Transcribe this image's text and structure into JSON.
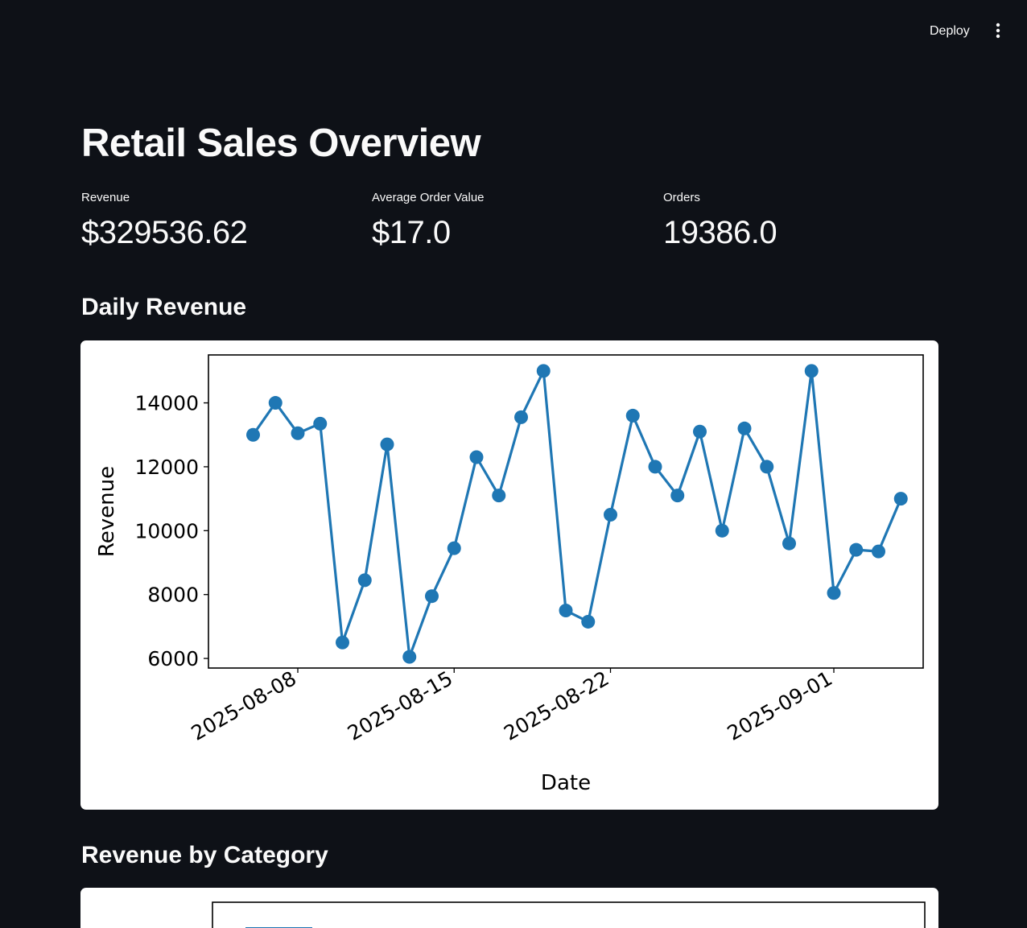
{
  "header": {
    "deploy_label": "Deploy",
    "menu_icon": "vertical-ellipsis-icon"
  },
  "page": {
    "title": "Retail Sales Overview"
  },
  "metrics": [
    {
      "label": "Revenue",
      "value": "$329536.62"
    },
    {
      "label": "Average Order Value",
      "value": "$17.0"
    },
    {
      "label": "Orders",
      "value": "19386.0"
    }
  ],
  "sections": {
    "daily_revenue": "Daily Revenue",
    "revenue_by_category": "Revenue by Category"
  },
  "colors": {
    "background": "#0e1117",
    "text": "#fafafa",
    "series": "#1f77b4"
  },
  "chart_data": [
    {
      "type": "line",
      "title": "",
      "xlabel": "Date",
      "ylabel": "Revenue",
      "ylim": [
        5700,
        15500
      ],
      "xlim": [
        "2025-08-04",
        "2025-09-05"
      ],
      "yticks": [
        6000,
        8000,
        10000,
        12000,
        14000
      ],
      "xticks": [
        "2025-08-08",
        "2025-08-15",
        "2025-08-22",
        "2025-09-01"
      ],
      "grid": false,
      "markers": true,
      "series": [
        {
          "x": [
            "2025-08-06",
            "2025-08-07",
            "2025-08-08",
            "2025-08-09",
            "2025-08-10",
            "2025-08-11",
            "2025-08-12",
            "2025-08-13",
            "2025-08-14",
            "2025-08-15",
            "2025-08-16",
            "2025-08-17",
            "2025-08-18",
            "2025-08-19",
            "2025-08-20",
            "2025-08-21",
            "2025-08-22",
            "2025-08-23",
            "2025-08-24",
            "2025-08-25",
            "2025-08-26",
            "2025-08-27",
            "2025-08-28",
            "2025-08-29",
            "2025-08-30",
            "2025-08-31",
            "2025-09-01",
            "2025-09-02",
            "2025-09-03",
            "2025-09-04"
          ],
          "y": [
            13000,
            14000,
            13050,
            13350,
            6500,
            8450,
            12700,
            6050,
            7950,
            9450,
            12300,
            11100,
            13550,
            15000,
            7500,
            7150,
            10500,
            13600,
            12000,
            11100,
            13100,
            10000,
            13200,
            12000,
            9600,
            15000,
            8050,
            9400,
            9350,
            11000
          ]
        }
      ]
    },
    {
      "type": "bar",
      "title": "",
      "note": "Chart is cut off at the bottom of the screenshot; only the top of the frame and first bar edge are visible.",
      "categories": [],
      "values": []
    }
  ]
}
